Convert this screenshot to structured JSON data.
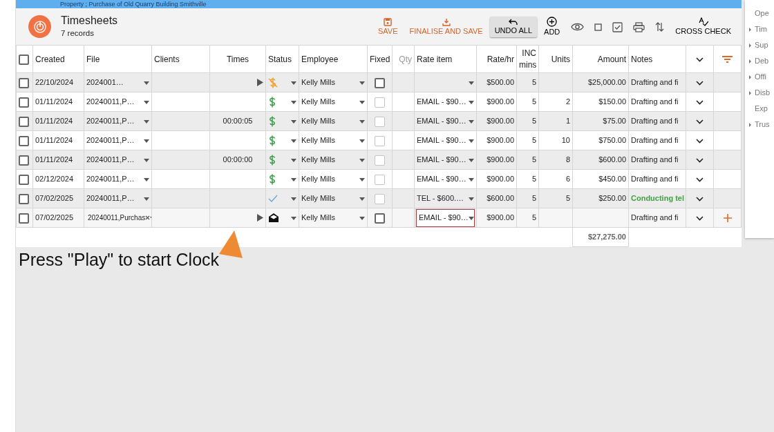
{
  "top_bar": {
    "title": "Property ; Purchase of Old Quarry Building Smithville"
  },
  "header": {
    "title": "Timesheets",
    "subtitle": "7 records"
  },
  "toolbar": [
    {
      "label": "SAVE",
      "accent": true,
      "highlighted": false
    },
    {
      "label": "FINALISE AND SAVE",
      "accent": true,
      "highlighted": false
    },
    {
      "label": "UNDO ALL",
      "accent": false,
      "highlighted": true
    },
    {
      "label": "ADD",
      "accent": false,
      "highlighted": false
    },
    {
      "label": "CROSS CHECK",
      "accent": false,
      "highlighted": false
    }
  ],
  "table": {
    "all_checked": false,
    "columns": [
      {
        "label": "Created",
        "muted": false
      },
      {
        "label": "File",
        "muted": false
      },
      {
        "label": "Clients",
        "muted": false
      },
      {
        "label": "Times",
        "muted": false
      },
      {
        "label": "Status",
        "muted": false
      },
      {
        "label": "Employee",
        "muted": false
      },
      {
        "label": "Fixed",
        "muted": false
      },
      {
        "label": "Qty",
        "muted": true
      },
      {
        "label": "Rate item",
        "muted": false
      },
      {
        "label": "Rate/hr",
        "muted": false
      },
      {
        "label": "INC mins",
        "muted": false
      },
      {
        "label": "Units",
        "muted": false
      },
      {
        "label": "Amount",
        "muted": false
      },
      {
        "label": "Notes",
        "muted": false
      }
    ],
    "rows": [
      {
        "checked": false,
        "created": "22/10/2024",
        "file": "2024001…",
        "times": "",
        "play": true,
        "status": {
          "kind": "unbilled"
        },
        "employee": "Kelly Mills",
        "fixed_disabled": false,
        "rate_item": "",
        "rate": "$500.00",
        "inc": "5",
        "units": "",
        "amount": "$25,000.00",
        "notes": "Drafting and fi",
        "note_flagged": false,
        "editing": false
      },
      {
        "checked": false,
        "created": "01/11/2024",
        "file": "20240011,P…",
        "times": "",
        "play": false,
        "status": {
          "kind": "billable"
        },
        "employee": "Kelly Mills",
        "fixed_disabled": true,
        "rate_item": "EMAIL - $90…",
        "rate": "$900.00",
        "inc": "5",
        "units": "2",
        "amount": "$150.00",
        "notes": "Drafting and fi",
        "note_flagged": false,
        "editing": false
      },
      {
        "checked": false,
        "created": "01/11/2024",
        "file": "20240011,P…",
        "times": "00:00:05",
        "play": false,
        "status": {
          "kind": "billable"
        },
        "employee": "Kelly Mills",
        "fixed_disabled": true,
        "rate_item": "EMAIL - $90…",
        "rate": "$900.00",
        "inc": "5",
        "units": "1",
        "amount": "$75.00",
        "notes": "Drafting and fi",
        "note_flagged": false,
        "editing": false
      },
      {
        "checked": false,
        "created": "01/11/2024",
        "file": "20240011,P…",
        "times": "",
        "play": false,
        "status": {
          "kind": "billable"
        },
        "employee": "Kelly Mills",
        "fixed_disabled": true,
        "rate_item": "EMAIL - $90…",
        "rate": "$900.00",
        "inc": "5",
        "units": "10",
        "amount": "$750.00",
        "notes": "Drafting and fi",
        "note_flagged": false,
        "editing": false
      },
      {
        "checked": false,
        "created": "01/11/2024",
        "file": "20240011,P…",
        "times": "00:00:00",
        "play": false,
        "status": {
          "kind": "billable"
        },
        "employee": "Kelly Mills",
        "fixed_disabled": true,
        "rate_item": "EMAIL - $90…",
        "rate": "$900.00",
        "inc": "5",
        "units": "8",
        "amount": "$600.00",
        "notes": "Drafting and fi",
        "note_flagged": false,
        "editing": false
      },
      {
        "checked": false,
        "created": "02/12/2024",
        "file": "20240011,P…",
        "times": "",
        "play": false,
        "status": {
          "kind": "billable"
        },
        "employee": "Kelly Mills",
        "fixed_disabled": true,
        "rate_item": "EMAIL - $90…",
        "rate": "$900.00",
        "inc": "5",
        "units": "6",
        "amount": "$450.00",
        "notes": "Drafting and fi",
        "note_flagged": false,
        "editing": false
      },
      {
        "checked": false,
        "created": "07/02/2025",
        "file": "20240011,P…",
        "times": "",
        "play": false,
        "status": {
          "kind": "billed"
        },
        "employee": "Kelly Mills",
        "fixed_disabled": true,
        "rate_item": "TEL - $600.…",
        "rate": "$600.00",
        "inc": "5",
        "units": "5",
        "amount": "$250.00",
        "notes": "Conducting tel",
        "note_flagged": true,
        "editing": false
      },
      {
        "checked": false,
        "created": "07/02/2025",
        "file": "20240011,Purchas",
        "times": "",
        "play": true,
        "status": {
          "kind": "email"
        },
        "employee": "Kelly Mills",
        "fixed_disabled": false,
        "rate_item": "EMAIL - $90…",
        "rate": "$900.00",
        "inc": "5",
        "units": "",
        "amount": "",
        "notes": "Drafting and fi",
        "note_flagged": false,
        "editing": true
      }
    ],
    "total": "$27,275.00"
  },
  "callout": {
    "text": "Press \"Play\" to start Clock"
  },
  "side_panel": {
    "items": [
      {
        "label": "Ope",
        "expandable": false
      },
      {
        "label": "Tim",
        "expandable": true
      },
      {
        "label": "Sup",
        "expandable": true
      },
      {
        "label": "Deb",
        "expandable": true
      },
      {
        "label": "Offi",
        "expandable": true
      },
      {
        "label": "Disb",
        "expandable": true
      },
      {
        "label": "Exp",
        "expandable": false
      },
      {
        "label": "Trus",
        "expandable": true
      }
    ]
  }
}
